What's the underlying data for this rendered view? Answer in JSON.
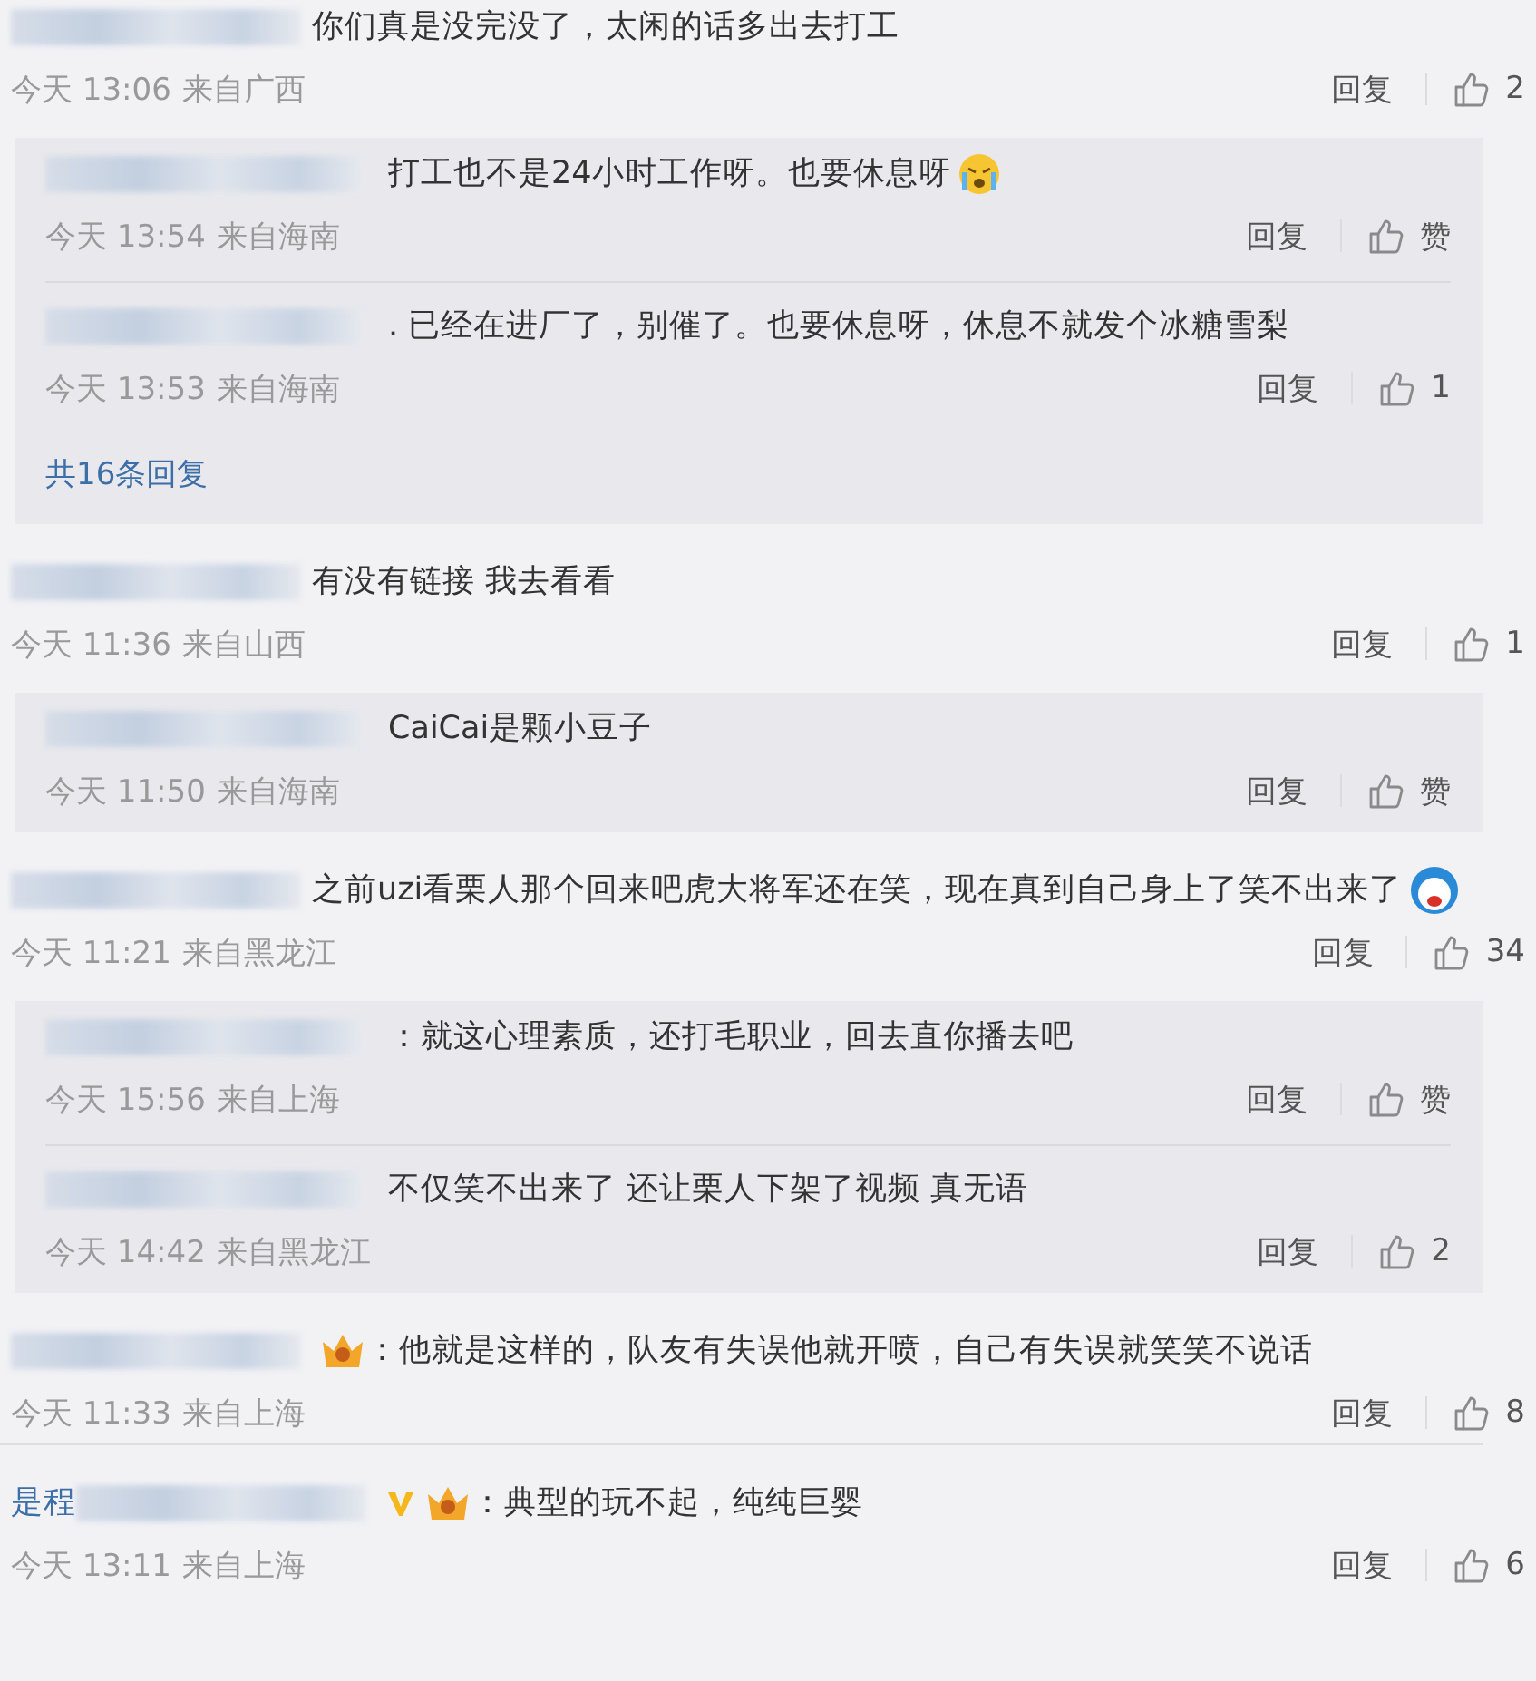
{
  "comments": [
    {
      "text": "你们真是没完没了，太闲的话多出去打工",
      "time": "今天 13:06",
      "source": "来自广西",
      "reply_label": "回复",
      "likes": "2",
      "replies": [
        {
          "text": "打工也不是24小时工作呀。也要休息呀",
          "emoji": {
            "kind": "crying"
          },
          "time": "今天 13:54",
          "source": "来自海南",
          "reply_label": "回复",
          "likes": "赞"
        },
        {
          "text": ". 已经在进厂了，别催了。也要休息呀，休息不就发个冰糖雪梨",
          "time": "今天 13:53",
          "source": "来自海南",
          "reply_label": "回复",
          "likes": "1"
        }
      ],
      "more_replies": "共16条回复"
    },
    {
      "text": "有没有链接 我去看看",
      "time": "今天 11:36",
      "source": "来自山西",
      "reply_label": "回复",
      "likes": "1",
      "replies": [
        {
          "text": "CaiCai是颗小豆子",
          "time": "今天 11:50",
          "source": "来自海南",
          "reply_label": "回复",
          "likes": "赞"
        }
      ]
    },
    {
      "text": "之前uzi看栗人那个回来吧虎大将军还在笑，现在真到自己身上了笑不出来了",
      "emoji": {
        "kind": "cartoon"
      },
      "time": "今天 11:21",
      "source": "来自黑龙江",
      "reply_label": "回复",
      "likes": "34",
      "replies": [
        {
          "text": "：就这心理素质，还打毛职业，回去直你播去吧",
          "time": "今天 15:56",
          "source": "来自上海",
          "reply_label": "回复",
          "likes": "赞"
        },
        {
          "text": "不仅笑不出来了 还让栗人下架了视频 真无语",
          "time": "今天 14:42",
          "source": "来自黑龙江",
          "reply_label": "回复",
          "likes": "2"
        }
      ]
    },
    {
      "badges": [
        {
          "kind": "crown"
        }
      ],
      "text": "：他就是这样的，队友有失误他就开喷，自己有失误就笑笑不说话",
      "time": "今天 11:33",
      "source": "来自上海",
      "reply_label": "回复",
      "likes": "8"
    },
    {
      "name_visible": "是程",
      "badges": [
        {
          "kind": "v"
        },
        {
          "kind": "crown"
        }
      ],
      "text": "：典型的玩不起，纯纯巨婴",
      "time": "今天 13:11",
      "source": "来自上海",
      "reply_label": "回复",
      "likes": "6"
    }
  ]
}
